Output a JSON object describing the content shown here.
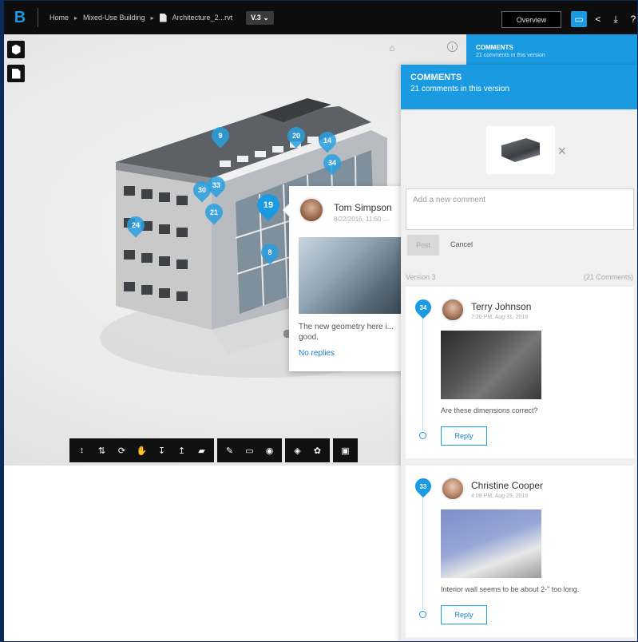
{
  "topbar": {
    "logo": "B",
    "breadcrumb": {
      "home": "Home",
      "project": "Mixed-Use Building",
      "file": "Architecture_2...rvt",
      "version": "V.3"
    },
    "overview_label": "Overview",
    "icons": [
      "comment-icon",
      "share-icon",
      "download-icon",
      "help-icon"
    ]
  },
  "viewer": {
    "markers": [
      "9",
      "20",
      "14",
      "34",
      "30",
      "33",
      "21",
      "19",
      "24",
      "8"
    ],
    "popup": {
      "name": "Tom Simpson",
      "date": "8/22/2016, 11:50 ...",
      "text": "The new geometry here i... good.",
      "link": "No replies"
    }
  },
  "panel_underlay": {
    "title": "COMMENTS",
    "subtitle": "21 comments in this version"
  },
  "comments_panel": {
    "title": "COMMENTS",
    "subtitle": "21 comments in this version",
    "placeholder": "Add a new comment",
    "post_label": "Post",
    "cancel_label": "Cancel",
    "version_label": "Version 3",
    "count_label": "(21 Comments)",
    "comments": [
      {
        "pin": "34",
        "name": "Terry Johnson",
        "date": "7:20 PM, Aug 31, 2016",
        "text": "Are these dimensions correct?",
        "reply_label": "Reply"
      },
      {
        "pin": "33",
        "name": "Christine Cooper",
        "date": "4:08 PM, Aug 29, 2016",
        "text": "Interior wall seems to be about 2-\" too long.",
        "reply_label": "Reply"
      }
    ]
  },
  "colors": {
    "accent": "#1a9ae0",
    "topbar": "#0d0d0d",
    "frame": "#0b2a5a"
  }
}
